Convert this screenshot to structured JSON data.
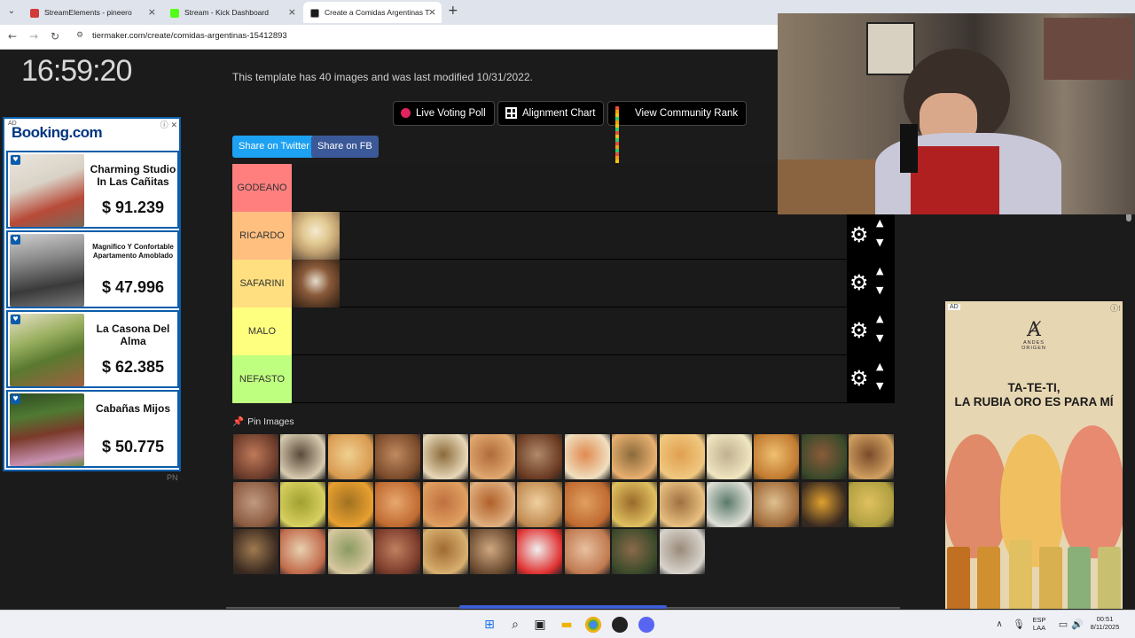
{
  "browser": {
    "tabs": [
      {
        "title": "StreamElements - pineero",
        "color": "#d23a3a"
      },
      {
        "title": "Stream - Kick Dashboard",
        "color": "#53fc18"
      },
      {
        "title": "Create a Comidas Argentinas T",
        "color": "#1a1a1a"
      }
    ],
    "url": "tiermaker.com/create/comidas-argentinas-15412893"
  },
  "clock": "16:59:20",
  "booking_ad": {
    "ad_label": "AD",
    "logo": "Booking.com",
    "pn": "PN",
    "listings": [
      {
        "name": "Charming Studio In Las Cañitas",
        "price": "$ 91.239"
      },
      {
        "name": "Magnifico Y Confortable Apartamento Amoblado",
        "price": "$ 47.996"
      },
      {
        "name": "La Casona Del Alma",
        "price": "$ 62.385"
      },
      {
        "name": "Cabañas Mijos",
        "price": "$ 50.775"
      }
    ]
  },
  "tiermaker": {
    "template_info": "This template has 40 images and was last modified 10/31/2022.",
    "buttons": {
      "live_voting": "Live Voting Poll",
      "alignment": "Alignment Chart",
      "community": "View Community Rank"
    },
    "share_twitter": "Share on Twitter",
    "share_fb": "Share on FB",
    "tiers": [
      {
        "label": "GODEANO",
        "color": "#ff7f7f",
        "items": 0
      },
      {
        "label": "RICARDO",
        "color": "#ffbf7f",
        "items": 1
      },
      {
        "label": "SAFARINI",
        "color": "#ffdf7f",
        "items": 1
      },
      {
        "label": "MALO",
        "color": "#ffff7f",
        "items": 0
      },
      {
        "label": "NEFASTO",
        "color": "#bfff7f",
        "items": 0
      }
    ],
    "pin_images_label": "Pin Images",
    "pool_count": 38
  },
  "beer_ad": {
    "ad_label": "AD",
    "brand": "ANDES ORIGEN",
    "slogan_line1": "TA-TE-TI,",
    "slogan_line2": "LA RUBIA ORO ES PARA MÍ"
  },
  "taskbar": {
    "lang1": "ESP",
    "lang2": "LAA",
    "time": "00:51",
    "date": "8/11/2025"
  }
}
